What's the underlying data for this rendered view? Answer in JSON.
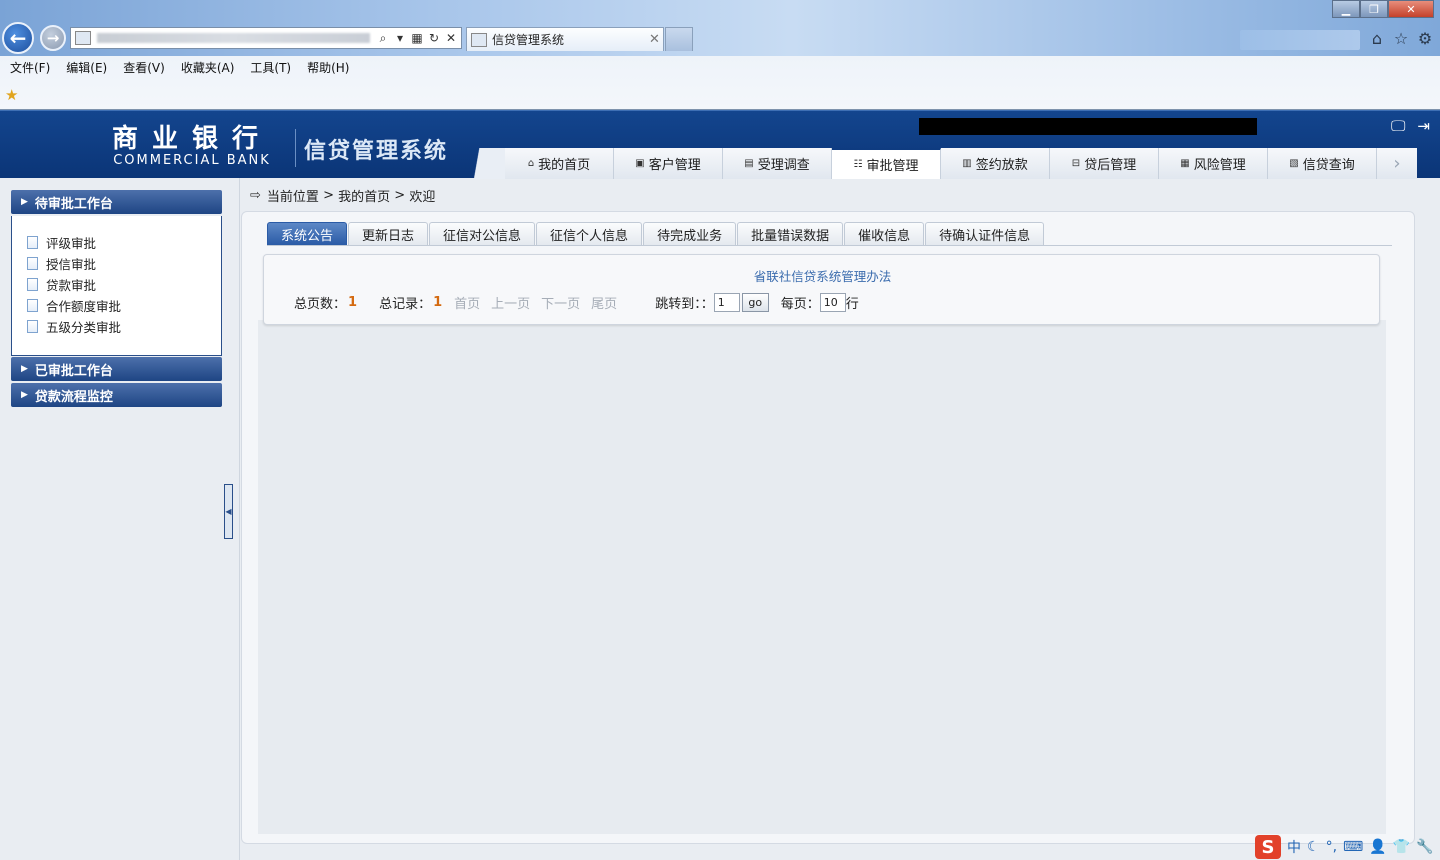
{
  "browser": {
    "tab_title": "信贷管理系统",
    "menu": [
      "文件(F)",
      "编辑(E)",
      "查看(V)",
      "收藏夹(A)",
      "工具(T)",
      "帮助(H)"
    ]
  },
  "header": {
    "logo_cn": "商业银行",
    "logo_en": "COMMERCIAL BANK",
    "system_title": "信贷管理系统"
  },
  "topnav": [
    {
      "label": "我的首页",
      "icon": "home-icon",
      "glyph": "⌂",
      "active": false
    },
    {
      "label": "客户管理",
      "icon": "customer-icon",
      "glyph": "▣",
      "active": false
    },
    {
      "label": "受理调查",
      "icon": "survey-icon",
      "glyph": "▤",
      "active": false
    },
    {
      "label": "审批管理",
      "icon": "approval-icon",
      "glyph": "☷",
      "active": true
    },
    {
      "label": "签约放款",
      "icon": "contract-icon",
      "glyph": "▥",
      "active": false
    },
    {
      "label": "贷后管理",
      "icon": "post-loan-icon",
      "glyph": "⊟",
      "active": false
    },
    {
      "label": "风险管理",
      "icon": "risk-icon",
      "glyph": "▦",
      "active": false
    },
    {
      "label": "信贷查询",
      "icon": "query-icon",
      "glyph": "▧",
      "active": false
    }
  ],
  "sidebar": {
    "section1": "待审批工作台",
    "items": [
      "评级审批",
      "授信审批",
      "贷款审批",
      "合作额度审批",
      "五级分类审批"
    ],
    "section2": "已审批工作台",
    "section3": "贷款流程监控"
  },
  "breadcrumb": {
    "prefix": "当前位置",
    "sep": ">",
    "level1": "我的首页",
    "level2": "欢迎"
  },
  "subtabs": [
    "系统公告",
    "更新日志",
    "征信对公信息",
    "征信个人信息",
    "待完成业务",
    "批量错误数据",
    "催收信息",
    "待确认证件信息"
  ],
  "notice": {
    "link": "省联社信贷系统管理办法"
  },
  "pager": {
    "total_pages_label": "总页数：",
    "total_pages": "1",
    "total_records_label": "总记录：",
    "total_records": "1",
    "first": "首页",
    "prev": "上一页",
    "next": "下一页",
    "last": "尾页",
    "jump_label": "跳转到：：",
    "jump_value": "1",
    "go": "go",
    "per_page_label": "每页：",
    "per_page_value": "10",
    "per_page_unit": "行"
  },
  "ime": {
    "lang": "中"
  }
}
